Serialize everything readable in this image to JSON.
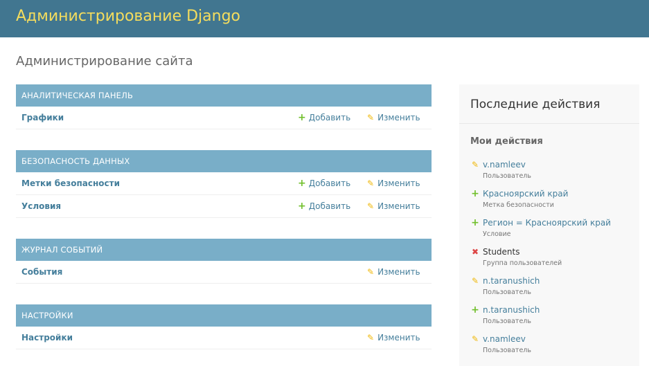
{
  "header": {
    "branding": "Администрирование Django"
  },
  "page_title": "Администрирование сайта",
  "modules": [
    {
      "caption": "АНАЛИТИЧЕСКАЯ ПАНЕЛЬ",
      "models": [
        {
          "name": "Графики",
          "add_label": "Добавить",
          "change_label": "Изменить"
        }
      ]
    },
    {
      "caption": "БЕЗОПАСНОСТЬ ДАННЫХ",
      "models": [
        {
          "name": "Метки безопасности",
          "add_label": "Добавить",
          "change_label": "Изменить"
        },
        {
          "name": "Условия",
          "add_label": "Добавить",
          "change_label": "Изменить"
        }
      ]
    },
    {
      "caption": "ЖУРНАЛ СОБЫТИЙ",
      "models": [
        {
          "name": "События",
          "change_label": "Изменить"
        }
      ]
    },
    {
      "caption": "НАСТРОЙКИ",
      "models": [
        {
          "name": "Настройки",
          "change_label": "Изменить"
        }
      ]
    }
  ],
  "recent_actions": {
    "title": "Последние действия",
    "my_actions_heading": "Мои действия",
    "items": [
      {
        "action": "change",
        "icon": "pencil-icon",
        "name": "v.namleev",
        "type": "Пользователь"
      },
      {
        "action": "add",
        "icon": "plus-icon",
        "name": "Красноярский край",
        "type": "Метка безопасности"
      },
      {
        "action": "add",
        "icon": "plus-icon",
        "name": "Регион = Красноярский край",
        "type": "Условие"
      },
      {
        "action": "delete",
        "icon": "delete-icon",
        "name": "Students",
        "type": "Группа пользователей"
      },
      {
        "action": "change",
        "icon": "pencil-icon",
        "name": "n.taranushich",
        "type": "Пользователь"
      },
      {
        "action": "add",
        "icon": "plus-icon",
        "name": "n.taranushich",
        "type": "Пользователь"
      },
      {
        "action": "change",
        "icon": "pencil-icon",
        "name": "v.namleev",
        "type": "Пользователь"
      }
    ]
  },
  "icons": {
    "add": "plus-icon",
    "change": "pencil-icon",
    "delete": "delete-icon"
  },
  "colors": {
    "header_bg": "#417690",
    "branding": "#f5dd5d",
    "module_caption_bg": "#79aec8",
    "link": "#447e9b",
    "add_icon": "#70bf2b",
    "change_icon": "#efb80b",
    "delete_icon": "#dd4646",
    "sidebar_bg": "#f8f8f8"
  }
}
